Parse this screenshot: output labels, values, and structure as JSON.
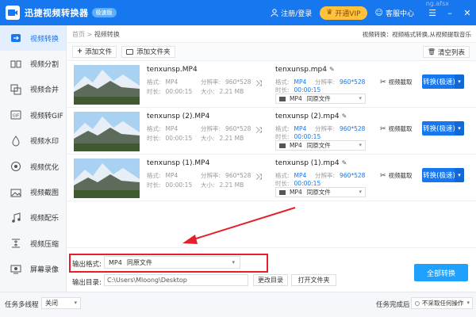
{
  "titlebar": {
    "app_title": "迅捷视频转换器",
    "edition": "极速版",
    "user_label": "注册/登录",
    "vip_label": "开通VIP",
    "service_label": "客服中心",
    "watermark": "ng.afsx",
    "brand_color": "#1677ee"
  },
  "sidebar": {
    "items": [
      {
        "label": "视频转换",
        "icon": "video-convert-icon",
        "active": true
      },
      {
        "label": "视频分割",
        "icon": "split-icon"
      },
      {
        "label": "视频合并",
        "icon": "merge-icon"
      },
      {
        "label": "视频转GIF",
        "icon": "gif-icon"
      },
      {
        "label": "视频水印",
        "icon": "watermark-icon"
      },
      {
        "label": "视频优化",
        "icon": "optimize-icon"
      },
      {
        "label": "视频截图",
        "icon": "screenshot-icon"
      },
      {
        "label": "视频配乐",
        "icon": "music-icon"
      },
      {
        "label": "视频压缩",
        "icon": "compress-icon"
      },
      {
        "label": "屏幕录像",
        "icon": "screen-record-icon"
      }
    ]
  },
  "main": {
    "breadcrumb_home": "首页",
    "breadcrumb_sep": ">",
    "breadcrumb_current": "视频转换",
    "promo": "视频转换：视频格式转换,从视频提取音乐",
    "add_file_label": "添加文件",
    "add_folder_label": "添加文件夹",
    "clear_label": "清空列表"
  },
  "labels": {
    "format": "格式:",
    "resolution": "分辨率:",
    "duration": "时长:",
    "size": "大小:",
    "same_as_source": "同原文件",
    "cut": "视频截取",
    "convert": "转换(极速)"
  },
  "files": [
    {
      "src_name": "tenxunsp.MP4",
      "src_format": "MP4",
      "src_res": "960*528",
      "src_dur": "00:00:15",
      "src_size": "2.21 MB",
      "dst_name": "tenxunsp.mp4",
      "dst_format": "MP4",
      "dst_res": "960*528",
      "dst_dur": "00:00:15",
      "out_format": "MP4"
    },
    {
      "src_name": "tenxunsp (2).MP4",
      "src_format": "MP4",
      "src_res": "960*528",
      "src_dur": "00:00:15",
      "src_size": "2.21 MB",
      "dst_name": "tenxunsp (2).mp4",
      "dst_format": "MP4",
      "dst_res": "960*528",
      "dst_dur": "00:00:15",
      "out_format": "MP4"
    },
    {
      "src_name": "tenxunsp (1).MP4",
      "src_format": "MP4",
      "src_res": "960*528",
      "src_dur": "00:00:15",
      "src_size": "2.21 MB",
      "dst_name": "tenxunsp (1).mp4",
      "dst_format": "MP4",
      "dst_res": "960*528",
      "dst_dur": "00:00:15",
      "out_format": "MP4"
    }
  ],
  "bottom": {
    "output_format_label": "输出格式:",
    "output_format_value": "MP4",
    "output_format_same": "同原文件",
    "output_dir_label": "输出目录:",
    "output_dir_value": "C:\\Users\\Mloong\\Desktop",
    "change_dir_label": "更改目录",
    "open_folder_label": "打开文件夹",
    "convert_all_label": "全部转换"
  },
  "statusbar": {
    "multithread_label": "任务多线程",
    "multithread_value": "关闭",
    "on_complete_label": "任务完成后",
    "on_complete_value": "不采取任何操作"
  }
}
